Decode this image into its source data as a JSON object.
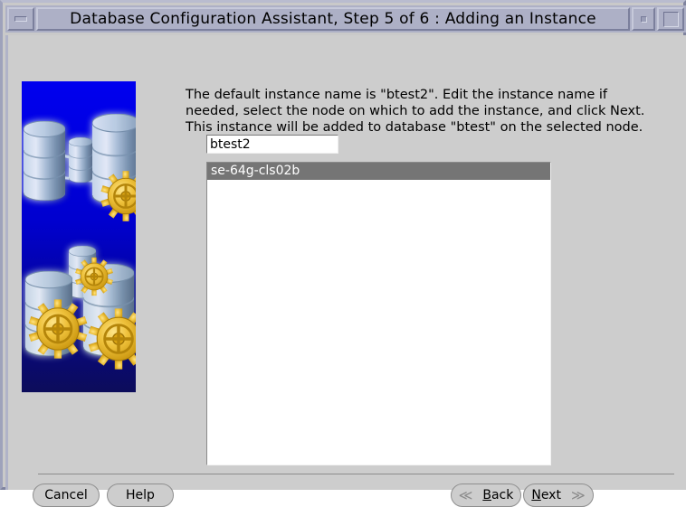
{
  "window": {
    "title": "Database Configuration Assistant, Step 5 of 6 : Adding an Instance",
    "minimize_label": "",
    "shade_label": "",
    "maximize_label": ""
  },
  "content": {
    "instructions": "The default instance name is \"btest2\". Edit the instance name if needed, select the node on which to add the instance, and click Next. This instance will be added to database \"btest\" on the selected node.",
    "instance_name_value": "btest2",
    "instance_name_placeholder": "",
    "node_list": [
      {
        "label": "se-64g-cls02b",
        "selected": true
      }
    ]
  },
  "footer": {
    "cancel_label": "Cancel",
    "help_label": "Help",
    "back_mnemonic": "B",
    "back_rest": "ack",
    "next_mnemonic": "N",
    "next_rest": "ext",
    "back_chevron": "≪",
    "next_chevron": "≫"
  },
  "colors": {
    "window_background": "#cdcdcd",
    "titlebar_background": "#adb0c6",
    "selection_background": "#757575",
    "selection_text": "#ffffff",
    "illustration_background": "#0000d8",
    "gear_color": "#e8b923",
    "cylinder_color": "#b9ccd8"
  }
}
